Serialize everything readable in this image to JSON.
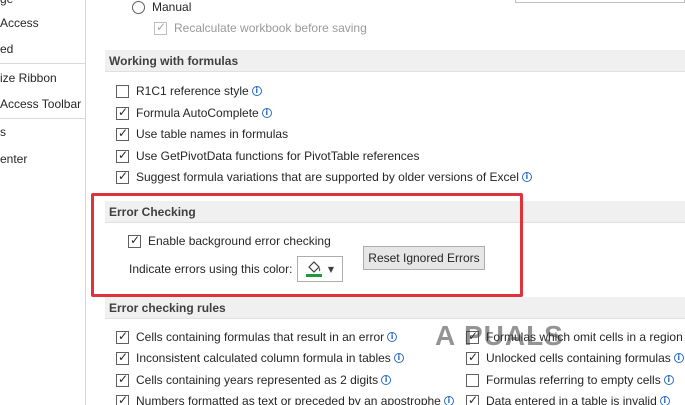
{
  "sidebar": {
    "items": [
      {
        "label": "ge"
      },
      {
        "label": "Access"
      },
      {
        "label": "ed"
      },
      {
        "label": "ize Ribbon"
      },
      {
        "label": "Access Toolbar"
      },
      {
        "label": "s"
      },
      {
        "label": "enter"
      }
    ]
  },
  "calculation": {
    "manual_label": "Manual",
    "recalc_label": "Recalculate workbook before saving"
  },
  "formulas": {
    "header": "Working with formulas",
    "items": [
      {
        "label": "R1C1 reference style",
        "checked": false,
        "info": true
      },
      {
        "label": "Formula AutoComplete",
        "checked": true,
        "info": true
      },
      {
        "label": "Use table names in formulas",
        "checked": true,
        "info": false
      },
      {
        "label": "Use GetPivotData functions for PivotTable references",
        "checked": true,
        "info": false
      },
      {
        "label": "Suggest formula variations that are supported by older versions of Excel",
        "checked": true,
        "info": true
      }
    ]
  },
  "error_checking": {
    "header": "Error Checking",
    "enable_label": "Enable background error checking",
    "indicate_label": "Indicate errors using this color:",
    "reset_button": "Reset Ignored Errors",
    "indicator_color": "#1d9a3a"
  },
  "rules": {
    "header": "Error checking rules",
    "left": [
      {
        "label": "Cells containing formulas that result in an error",
        "checked": true,
        "info": true
      },
      {
        "label": "Inconsistent calculated column formula in tables",
        "checked": true,
        "info": true
      },
      {
        "label": "Cells containing years represented as 2 digits",
        "checked": true,
        "info": true
      },
      {
        "label": "Numbers formatted as text or preceded by an apostrophe",
        "checked": true,
        "info": true
      }
    ],
    "right": [
      {
        "label": "Formulas which omit cells in a region",
        "checked": true,
        "info": true
      },
      {
        "label": "Unlocked cells containing formulas",
        "checked": true,
        "info": true
      },
      {
        "label": "Formulas referring to empty cells",
        "checked": false,
        "info": true
      },
      {
        "label": "Data entered in a table is invalid",
        "checked": true,
        "info": true
      }
    ]
  },
  "watermark": "A PUALS",
  "colors": {
    "highlight": "#e0323a",
    "info_icon": "#2b6cc4"
  }
}
